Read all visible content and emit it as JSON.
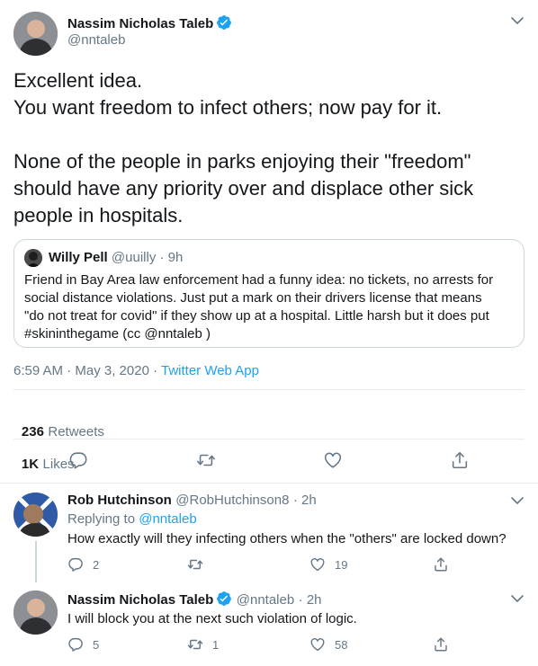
{
  "colors": {
    "accent": "#1da1f2",
    "secondary_text": "#657786",
    "border": "#ccd6dd"
  },
  "main_tweet": {
    "author_name": "Nassim Nicholas Taleb",
    "author_handle": "@nntaleb",
    "lines": [
      "Excellent idea.",
      "You want freedom to infect others; now pay for it.",
      "",
      "None of the people in parks enjoying their \"freedom\"",
      "should have any priority over and displace other sick",
      "people in hospitals."
    ],
    "quoted": {
      "name": "Willy Pell",
      "handle": "@uuilly",
      "time": "· 9h",
      "lines": [
        "Friend in Bay Area law enforcement had a funny idea: no tickets, no arrests for",
        "social distance violations. Just put a mark on their drivers license that means",
        "\"do not treat for covid\" if they show up at a hospital. Little harsh but it does put",
        "#skininthegame (cc @nntaleb )"
      ]
    },
    "timestamp": "6:59 AM · May 3, 2020 · ",
    "source": "Twitter Web App",
    "retweets_count": "236",
    "retweets_label": "Retweets",
    "likes_count": "1K",
    "likes_label": "Likes"
  },
  "replies": [
    {
      "name": "Rob Hutchinson",
      "handle": "@RobHutchinson8",
      "time": "· 2h",
      "replying_prefix": "Replying to ",
      "replying_handle": "@nntaleb",
      "text": "How exactly will they infecting others when the \"others\" are locked down?",
      "reply_count": "2",
      "retweet_count": "",
      "like_count": "19"
    },
    {
      "name": "Nassim Nicholas Taleb",
      "handle": "@nntaleb",
      "time": "· 2h",
      "text": "I will block you at the next such violation of logic.",
      "reply_count": "5",
      "retweet_count": "1",
      "like_count": "58"
    }
  ],
  "icons": [
    "verified-badge-icon",
    "chevron-down-icon",
    "reply-icon",
    "retweet-icon",
    "like-icon",
    "share-icon"
  ]
}
